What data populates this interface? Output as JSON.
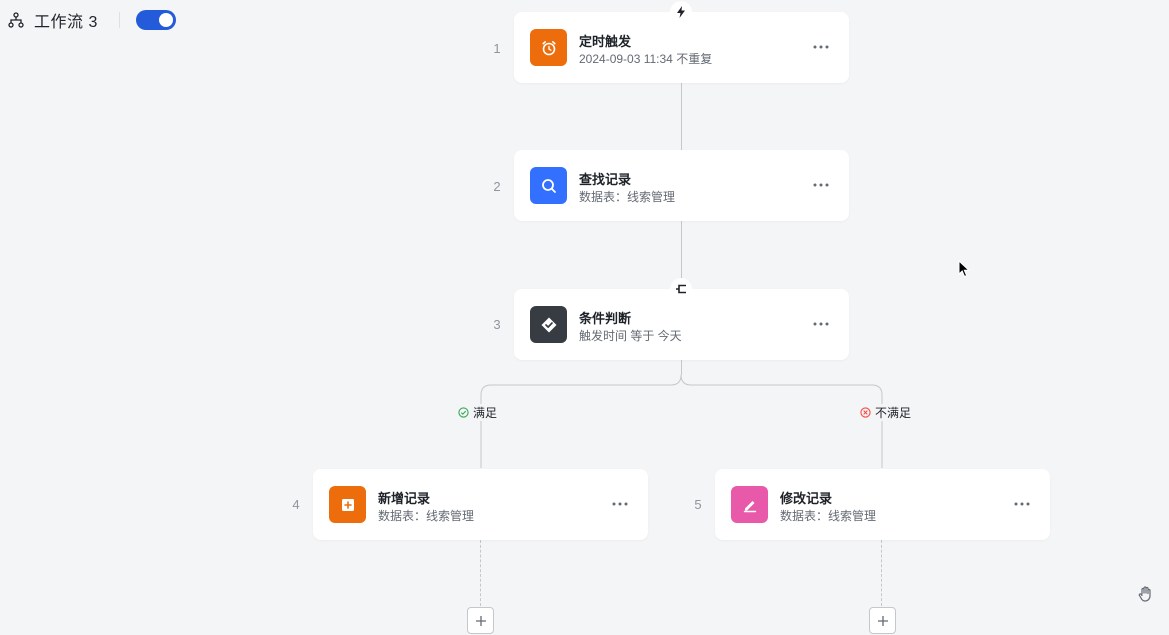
{
  "header": {
    "title": "工作流 3",
    "enabled": true,
    "workflow_icon": "workflow-tree-icon"
  },
  "colors": {
    "accent": "#245bdb",
    "timer": "#ed6d0c",
    "find": "#3370ff",
    "condition": "#373c43",
    "add": "#ed6d0c",
    "modify": "#e85aa9",
    "met": "#34a853",
    "not_met": "#f54a45"
  },
  "steps": [
    {
      "num": "1",
      "title": "定时触发",
      "sub": "2024-09-03 11:34 不重复",
      "icon": "alarm-clock-icon"
    },
    {
      "num": "2",
      "title": "查找记录",
      "sub": "数据表：线索管理",
      "icon": "search-icon"
    },
    {
      "num": "3",
      "title": "条件判断",
      "sub": "触发时间 等于 今天",
      "icon": "condition-check-icon"
    },
    {
      "num": "4",
      "title": "新增记录",
      "sub": "数据表：线索管理",
      "icon": "add-record-icon"
    },
    {
      "num": "5",
      "title": "修改记录",
      "sub": "数据表：线索管理",
      "icon": "edit-record-icon"
    }
  ],
  "branches": {
    "met_label": "满足",
    "not_met_label": "不满足"
  }
}
